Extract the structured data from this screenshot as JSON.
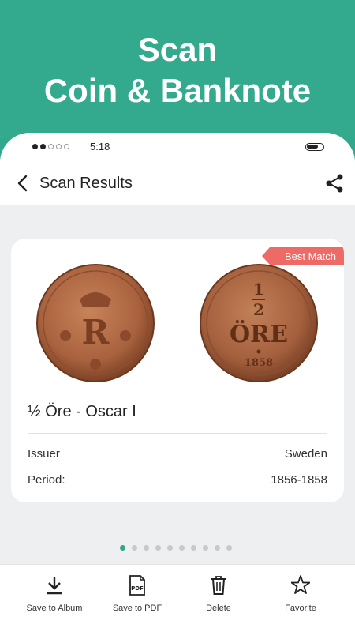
{
  "hero": {
    "line1": "Scan",
    "line2": "Coin & Banknote",
    "bg_color": "#33a98d"
  },
  "status_bar": {
    "time": "5:18"
  },
  "app_bar": {
    "title": "Scan Results"
  },
  "result": {
    "badge": "Best Match",
    "name": "½ Öre - Oscar I",
    "details": [
      {
        "label": "Issuer",
        "value": "Sweden"
      },
      {
        "label": "Period:",
        "value": "1856-1858"
      }
    ],
    "coin_images": [
      "coin-obverse-image",
      "coin-reverse-image"
    ]
  },
  "pager": {
    "count": 10,
    "active": 0
  },
  "toolbar": {
    "save_album": "Save to Album",
    "save_pdf": "Save to PDF",
    "delete": "Delete",
    "favorite": "Favorite"
  },
  "colors": {
    "accent": "#2fa88c",
    "badge": "#ee6a67",
    "background": "#eeeff1"
  }
}
